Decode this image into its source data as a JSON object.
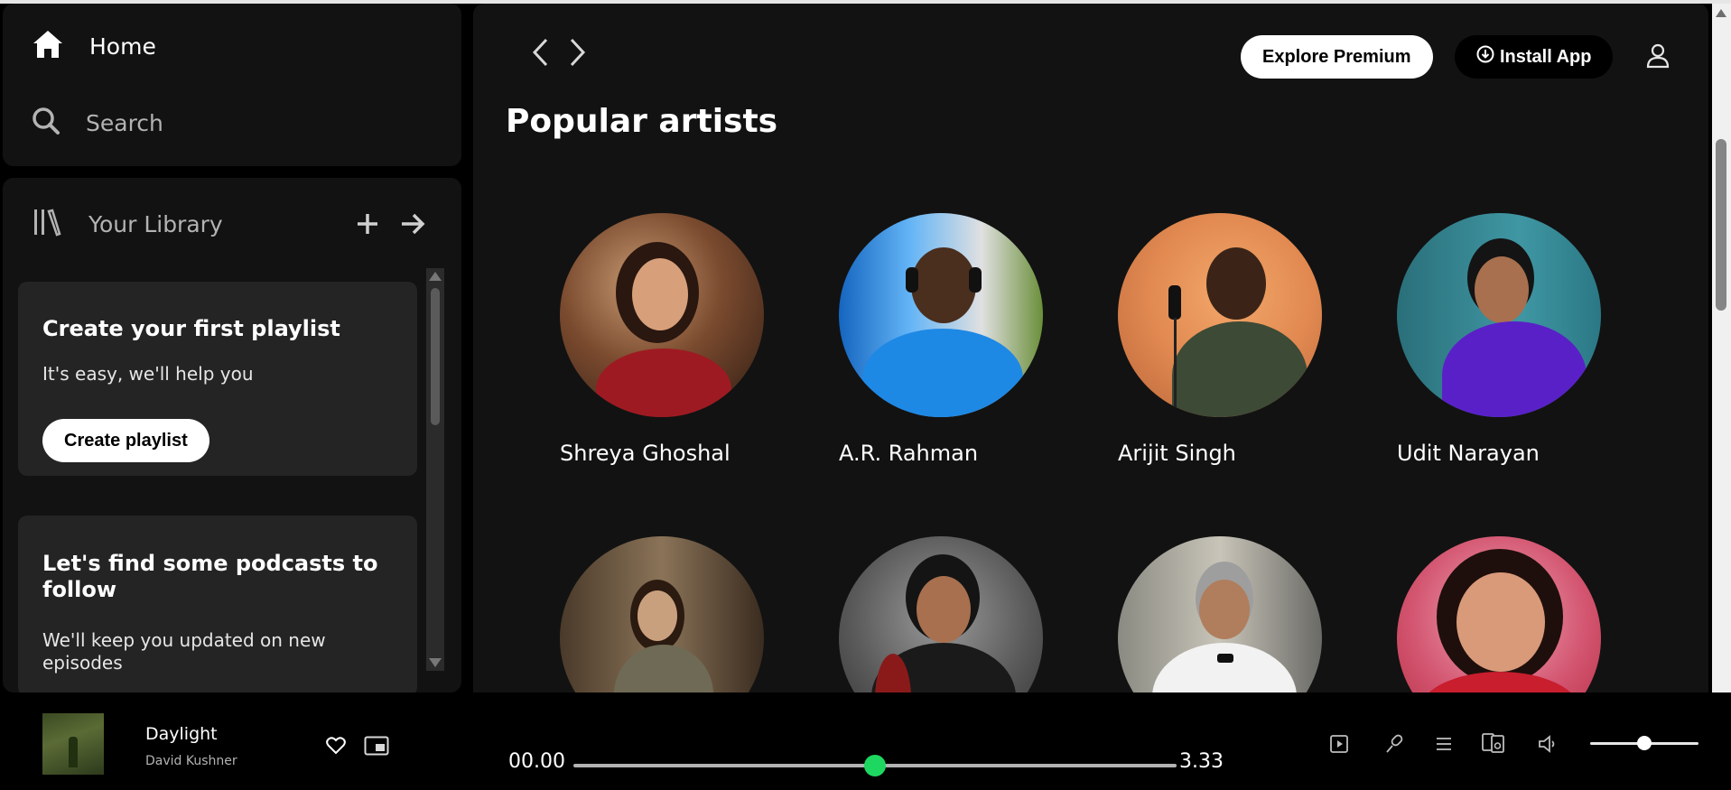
{
  "nav": {
    "home_label": "Home",
    "search_label": "Search"
  },
  "library": {
    "title": "Your Library",
    "playlist_card": {
      "title": "Create your first playlist",
      "text": "It's easy, we'll help you",
      "button": "Create playlist"
    },
    "podcast_card": {
      "title": "Let's find some podcasts to follow",
      "text": "We'll keep you updated on new episodes"
    }
  },
  "header": {
    "explore_label": "Explore Premium",
    "install_label": "Install App"
  },
  "main": {
    "section_title": "Popular artists",
    "artists": [
      {
        "name": "Shreya Ghoshal"
      },
      {
        "name": "A.R. Rahman"
      },
      {
        "name": "Arijit Singh"
      },
      {
        "name": "Udit Narayan"
      },
      {
        "name": ""
      },
      {
        "name": ""
      },
      {
        "name": ""
      },
      {
        "name": ""
      }
    ]
  },
  "player": {
    "track_title": "Daylight",
    "track_artist": "David Kushner",
    "elapsed": "00.00",
    "duration": "3.33",
    "progress_fraction": 0.5,
    "volume_fraction": 0.5
  },
  "colors": {
    "accent": "#1ed760",
    "panel": "#121212",
    "card": "#242424"
  }
}
